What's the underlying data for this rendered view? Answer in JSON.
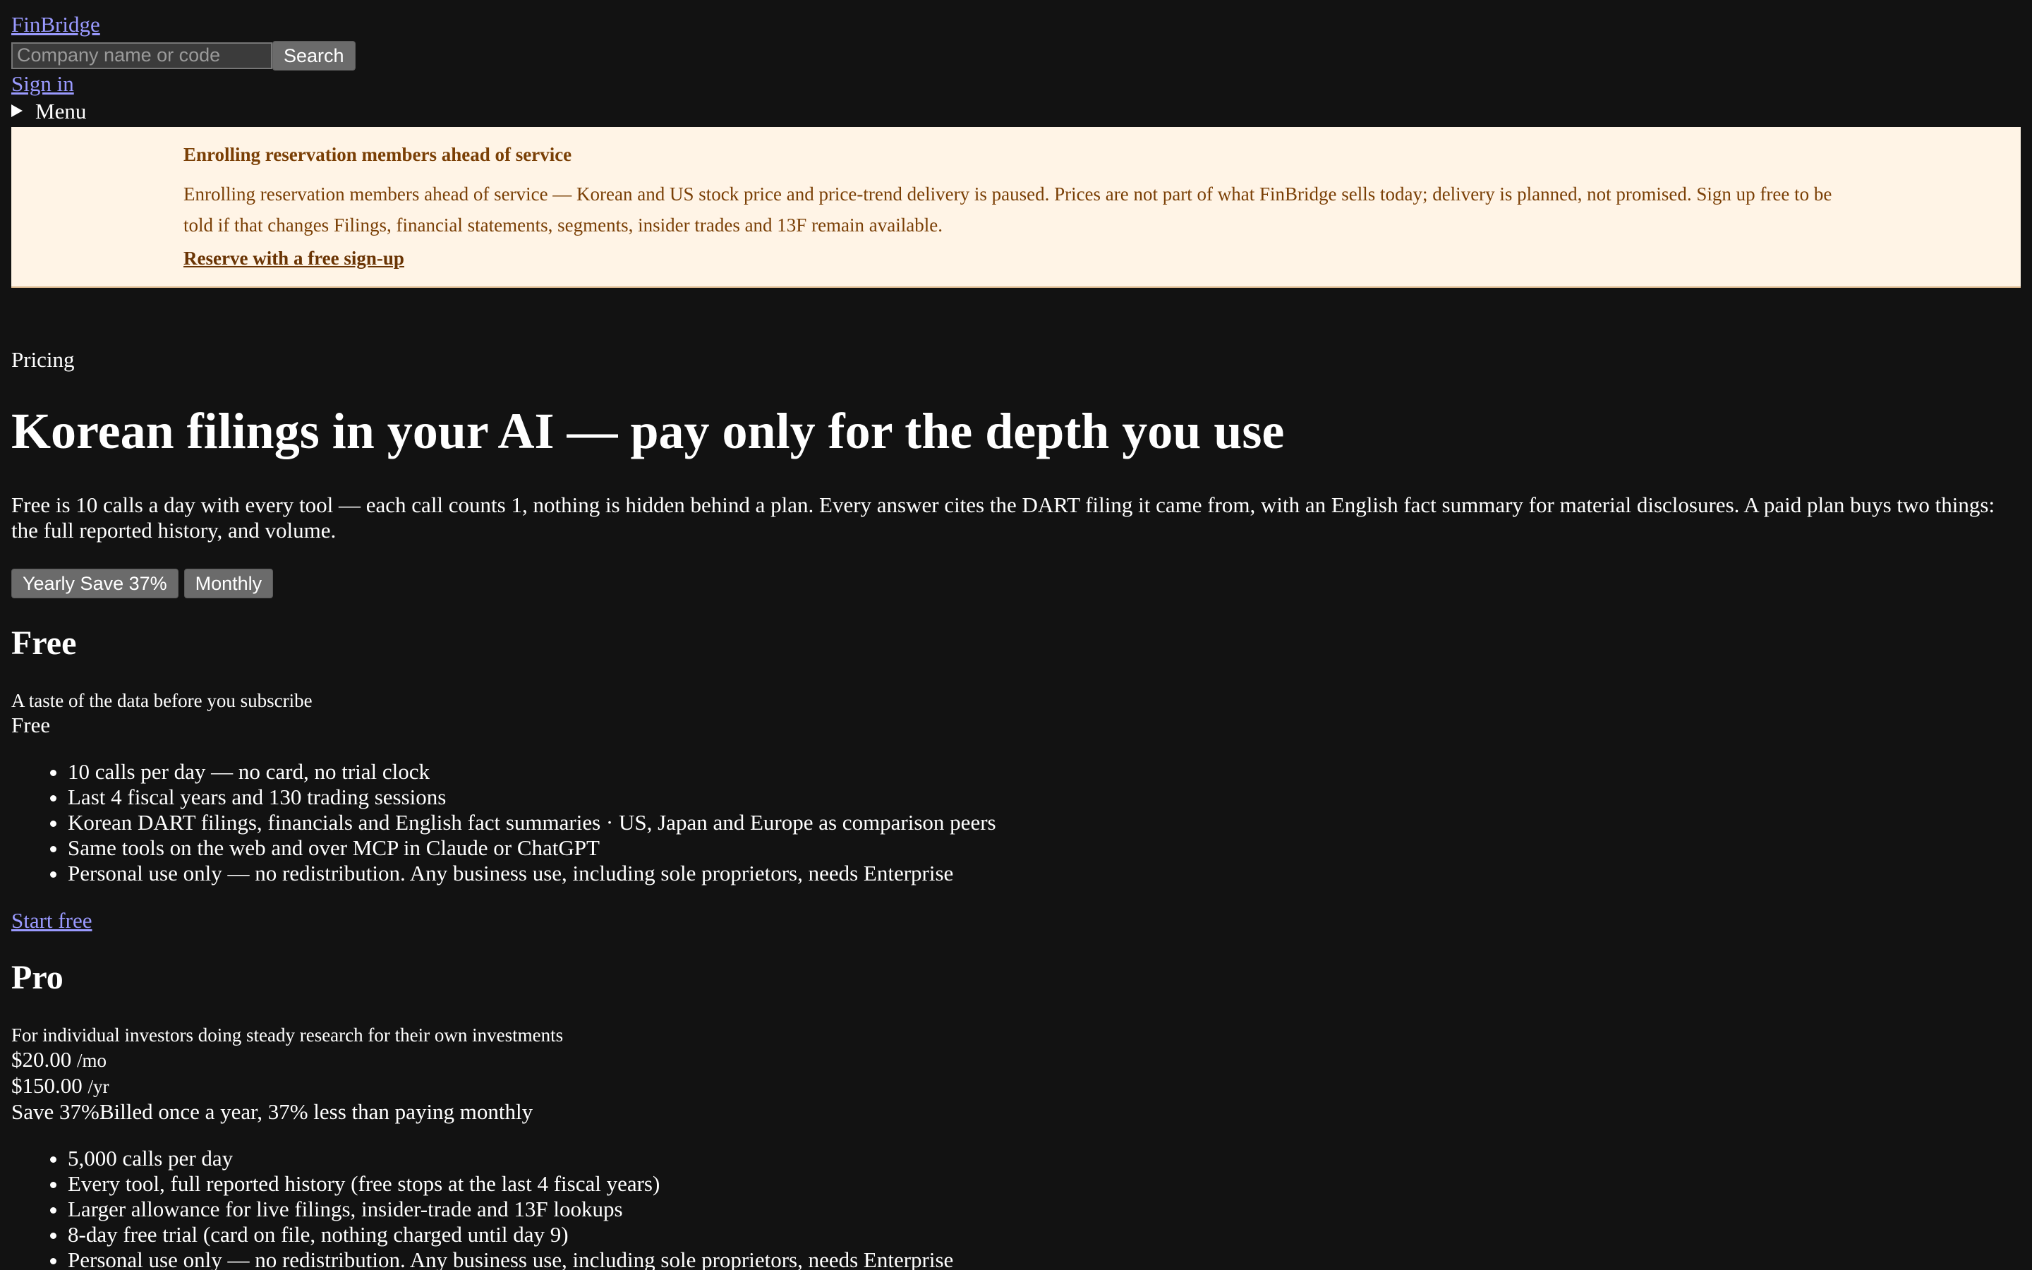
{
  "header": {
    "brand": "FinBridge",
    "search_placeholder": "Company name or code",
    "search_button": "Search",
    "sign_in": "Sign in",
    "menu": "Menu"
  },
  "banner": {
    "title": "Enrolling reservation members ahead of service",
    "body": "Enrolling reservation members ahead of service — Korean and US stock price and price-trend delivery is paused. Prices are not part of what FinBridge sells today; delivery is planned, not promised. Sign up free to be told if that changes Filings, financial statements, segments, insider trades and 13F remain available.",
    "link": "Reserve with a free sign-up"
  },
  "hero": {
    "eyebrow": "Pricing",
    "title": "Korean filings in your AI — pay only for the depth you use",
    "subtitle": "Free is 10 calls a day with every tool — each call counts 1, nothing is hidden behind a plan. Every answer cites the DART filing it came from, with an English fact summary for material disclosures. A paid plan buys two things: the full reported history, and volume."
  },
  "billing_toggle": {
    "yearly": "Yearly Save 37%",
    "monthly": "Monthly"
  },
  "plans": {
    "free": {
      "name": "Free",
      "description": "A taste of the data before you subscribe",
      "price": "Free",
      "features": [
        "10 calls per day — no card, no trial clock",
        "Last 4 fiscal years and 130 trading sessions",
        "Korean DART filings, financials and English fact summaries · US, Japan and Europe as comparison peers",
        "Same tools on the web and over MCP in Claude or ChatGPT",
        "Personal use only — no redistribution. Any business use, including sole proprietors, needs Enterprise"
      ],
      "cta": "Start free"
    },
    "pro": {
      "name": "Pro",
      "description": "For individual investors doing steady research for their own investments",
      "monthly_price": "$20.00",
      "monthly_unit": "/mo",
      "yearly_price": "$150.00",
      "yearly_unit": "/yr",
      "savings_note": "Save 37%Billed once a year, 37% less than paying monthly",
      "features": [
        "5,000 calls per day",
        "Every tool, full reported history (free stops at the last 4 fiscal years)",
        "Larger allowance for live filings, insider-trade and 13F lookups",
        "8-day free trial (card on file, nothing charged until day 9)",
        "Personal use only — no redistribution. Any business use, including sole proprietors, needs Enterprise"
      ]
    }
  }
}
